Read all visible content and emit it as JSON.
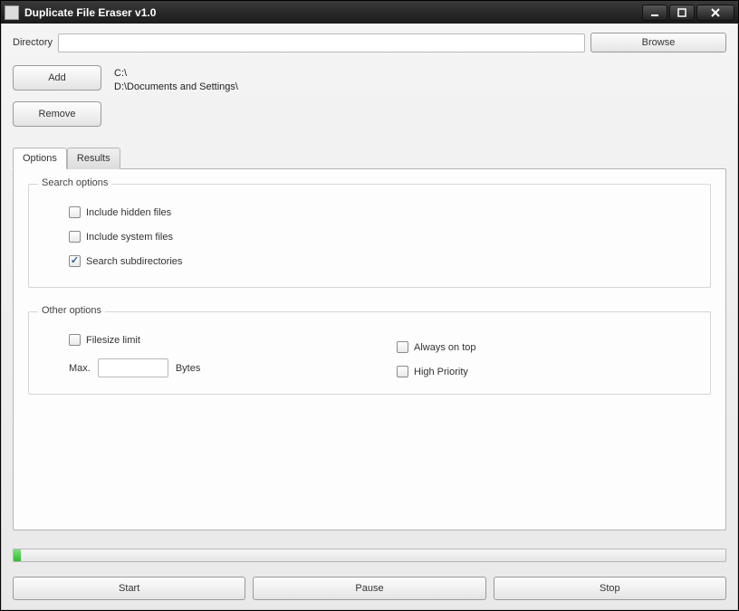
{
  "window": {
    "title": "Duplicate File Eraser v1.0"
  },
  "directory": {
    "label": "Directory",
    "value": "",
    "browse_label": "Browse"
  },
  "dirs": {
    "add_label": "Add",
    "remove_label": "Remove",
    "items": [
      "C:\\",
      "D:\\Documents and Settings\\"
    ]
  },
  "tabs": {
    "options_label": "Options",
    "results_label": "Results"
  },
  "search_options": {
    "legend": "Search options",
    "include_hidden": {
      "label": "Include hidden files",
      "checked": false
    },
    "include_system": {
      "label": "Include system files",
      "checked": false
    },
    "search_subdirs": {
      "label": "Search subdirectories",
      "checked": true
    }
  },
  "other_options": {
    "legend": "Other options",
    "filesize_limit": {
      "label": "Filesize limit",
      "checked": false
    },
    "max_label": "Max.",
    "max_value": "",
    "bytes_label": "Bytes",
    "always_on_top": {
      "label": "Always on top",
      "checked": false
    },
    "high_priority": {
      "label": "High Priority",
      "checked": false
    }
  },
  "progress": {
    "percent": 1
  },
  "footer": {
    "start_label": "Start",
    "pause_label": "Pause",
    "stop_label": "Stop"
  }
}
